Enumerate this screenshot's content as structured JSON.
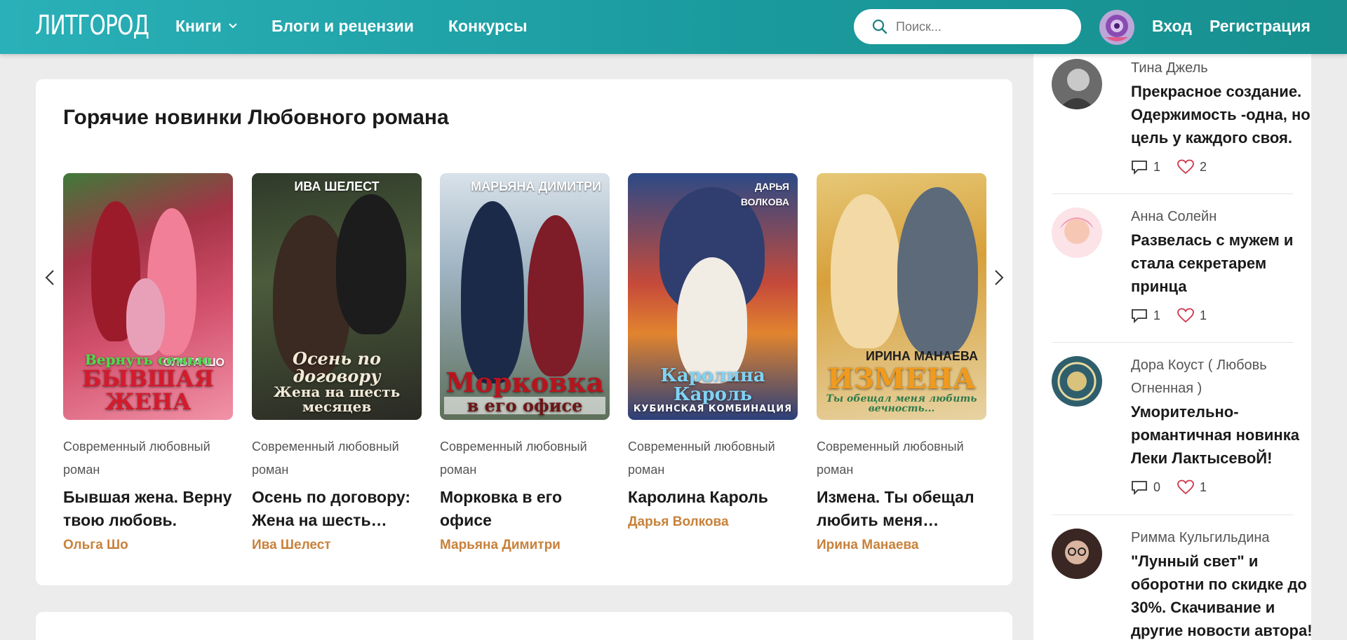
{
  "header": {
    "logo": "ЛИТГОРОД",
    "nav": {
      "books": "Книги",
      "blogs": "Блоги и рецензии",
      "contests": "Конкурсы"
    },
    "search_placeholder": "Поиск...",
    "login": "Вход",
    "register": "Регистрация"
  },
  "main": {
    "title": "Горячие новинки Любовного романа",
    "books": [
      {
        "genre": "Современный любовный роман",
        "title": "Бывшая жена. Верну твою любовь.",
        "author": "Ольга Шо",
        "cover_top": "ОЛЬГА ШО",
        "cover_sub": "Вернуть семью",
        "cover_title": "БЫВШАЯ ЖЕНА"
      },
      {
        "genre": "Современный любовный роман",
        "title": "Осень по договору: Жена на шесть месяцев",
        "author": "Ива Шелест",
        "cover_top": "ИВА ШЕЛЕСТ",
        "cover_sub": "Осень по договору",
        "cover_title": "Жена на шесть месяцев"
      },
      {
        "genre": "Современный любовный роман",
        "title": "Морковка в его офисе",
        "author": "Марьяна Димитри",
        "cover_top": "МАРЬЯНА ДИМИТРИ",
        "cover_sub": "Морковка",
        "cover_title": "в его офисе"
      },
      {
        "genre": "Современный любовный роман",
        "title": "Каролина Кароль",
        "author": "Дарья Волкова",
        "cover_top": "ДАРЬЯ ВОЛКОВА",
        "cover_sub": "Каролина Кароль",
        "cover_title": "КУБИНСКАЯ КОМБИНАЦИЯ"
      },
      {
        "genre": "Современный любовный роман",
        "title": "Измена. Ты обещал любить меня вечность",
        "author": "Ирина Манаева",
        "cover_top": "ИРИНА МАНАЕВА",
        "cover_sub": "ИЗМЕНА",
        "cover_title": "Ты обещал меня любить вечность..."
      }
    ]
  },
  "sidebar": {
    "posts": [
      {
        "author": "Тина Джель",
        "title": "Прекрасное создание. Одержимость -одна, но цель у каждого своя.",
        "comments": "1",
        "likes": "2"
      },
      {
        "author": "Анна Солейн",
        "title": "Развелась с мужем и стала секретарем принца",
        "comments": "1",
        "likes": "1"
      },
      {
        "author": "Дора Коуст ( Любовь Огненная )",
        "title": "Уморительно-романтичная новинка Леки ЛактысевоЙ!",
        "comments": "0",
        "likes": "1"
      },
      {
        "author": "Римма Кульгильдина",
        "title": "\"Лунный свет\" и оборотни по скидке до 30%. Скачивание и другие новости автора!",
        "comments": "",
        "likes": ""
      }
    ]
  },
  "colors": {
    "header_start": "#2ab0b8",
    "header_end": "#17908f",
    "author_accent": "#c8813a",
    "like_heart": "#d0344a"
  }
}
